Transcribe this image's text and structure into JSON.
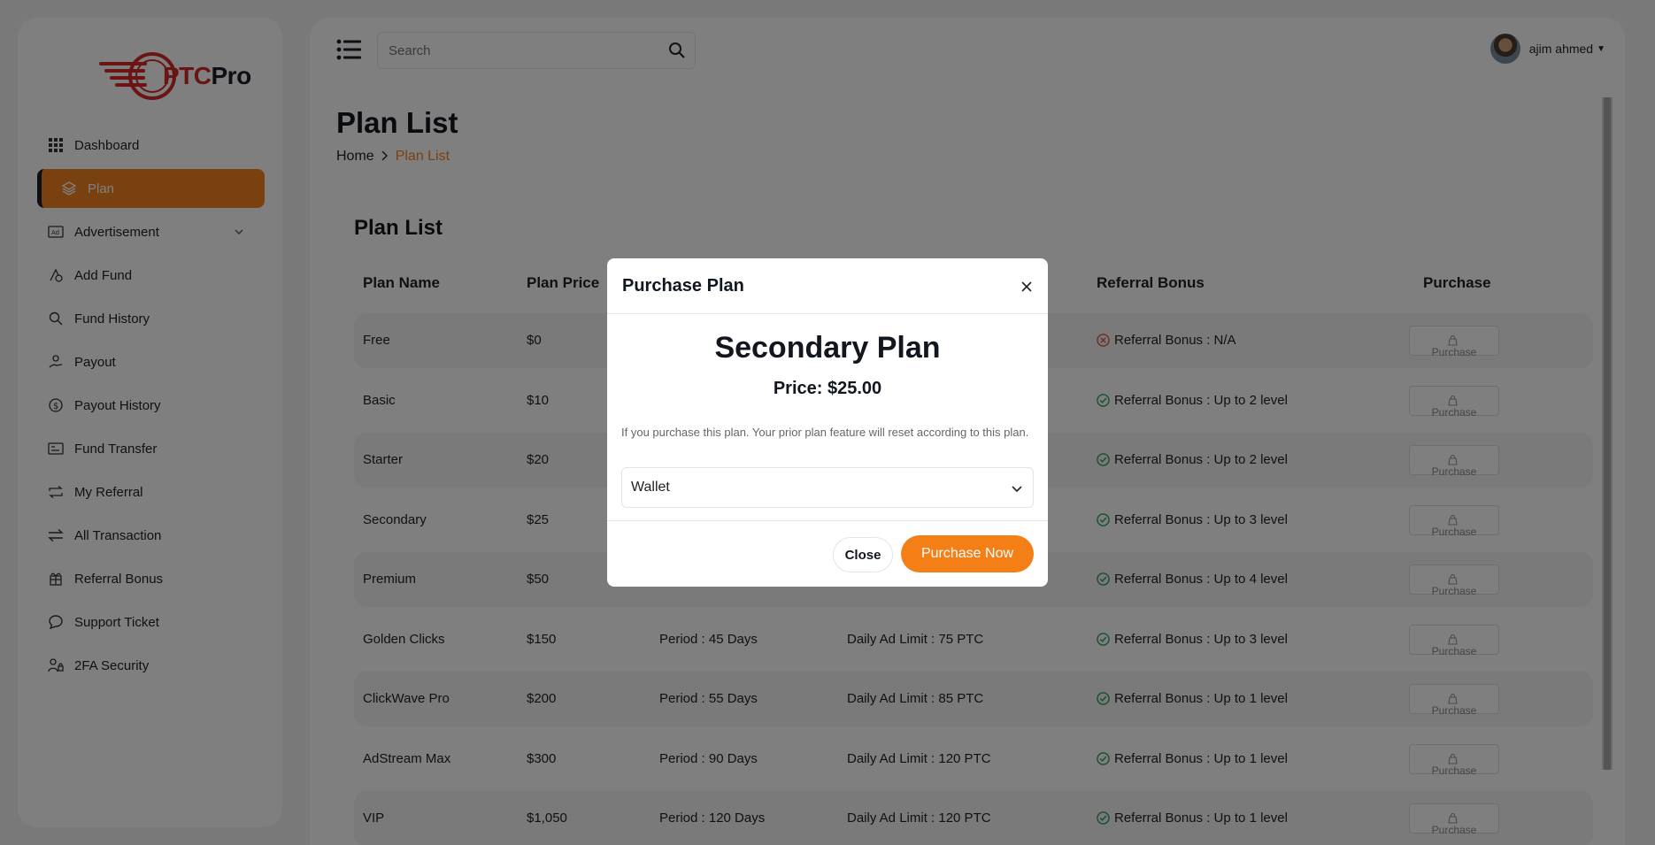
{
  "brand": {
    "logo_ptc": "PTC",
    "logo_pro": "Pro"
  },
  "sidebar": {
    "items": [
      {
        "label": "Dashboard",
        "icon": "grid-icon"
      },
      {
        "label": "Plan",
        "icon": "layers-icon",
        "active": true
      },
      {
        "label": "Advertisement",
        "icon": "ad-icon",
        "has_submenu": true
      },
      {
        "label": "Add Fund",
        "icon": "fund-icon"
      },
      {
        "label": "Fund History",
        "icon": "search-dollar-icon"
      },
      {
        "label": "Payout",
        "icon": "payout-icon"
      },
      {
        "label": "Payout History",
        "icon": "dollar-circle-icon"
      },
      {
        "label": "Fund Transfer",
        "icon": "card-icon"
      },
      {
        "label": "My Referral",
        "icon": "repeat-icon"
      },
      {
        "label": "All Transaction",
        "icon": "transfer-icon"
      },
      {
        "label": "Referral Bonus",
        "icon": "gift-icon"
      },
      {
        "label": "Support Ticket",
        "icon": "chat-icon"
      },
      {
        "label": "2FA Security",
        "icon": "user-lock-icon"
      }
    ]
  },
  "topbar": {
    "search_placeholder": "Search",
    "user_name": "ajim ahmed"
  },
  "page": {
    "title": "Plan List",
    "breadcrumb_home": "Home",
    "breadcrumb_current": "Plan List"
  },
  "table": {
    "title": "Plan List",
    "headers": {
      "name": "Plan Name",
      "price": "Plan Price",
      "referral": "Referral Bonus",
      "purchase": "Purchase"
    },
    "purchase_label": "Purchase",
    "rows": [
      {
        "name": "Free",
        "price": "$0",
        "period": "",
        "limit": "",
        "referral": "Referral Bonus : N/A",
        "ref_ok": false
      },
      {
        "name": "Basic",
        "price": "$10",
        "period": "",
        "limit": "",
        "referral": "Referral Bonus : Up to 2 level",
        "ref_ok": true
      },
      {
        "name": "Starter",
        "price": "$20",
        "period": "",
        "limit": "",
        "referral": "Referral Bonus : Up to 2 level",
        "ref_ok": true
      },
      {
        "name": "Secondary",
        "price": "$25",
        "period": "",
        "limit": "",
        "referral": "Referral Bonus : Up to 3 level",
        "ref_ok": true
      },
      {
        "name": "Premium",
        "price": "$50",
        "period": "",
        "limit": "",
        "referral": "Referral Bonus : Up to 4 level",
        "ref_ok": true
      },
      {
        "name": "Golden Clicks",
        "price": "$150",
        "period": "Period : 45 Days",
        "limit": "Daily Ad Limit : 75 PTC",
        "referral": "Referral Bonus : Up to 3 level",
        "ref_ok": true
      },
      {
        "name": "ClickWave Pro",
        "price": "$200",
        "period": "Period : 55 Days",
        "limit": "Daily Ad Limit : 85 PTC",
        "referral": "Referral Bonus : Up to 1 level",
        "ref_ok": true
      },
      {
        "name": "AdStream Max",
        "price": "$300",
        "period": "Period : 90 Days",
        "limit": "Daily Ad Limit : 120 PTC",
        "referral": "Referral Bonus : Up to 1 level",
        "ref_ok": true
      },
      {
        "name": "VIP",
        "price": "$1,050",
        "period": "Period : 120 Days",
        "limit": "Daily Ad Limit : 120 PTC",
        "referral": "Referral Bonus : Up to 1 level",
        "ref_ok": true
      }
    ]
  },
  "modal": {
    "title": "Purchase Plan",
    "plan_name": "Secondary Plan",
    "price": "Price: $25.00",
    "note": "If you purchase this plan. Your prior plan feature will reset according to this plan.",
    "payment_method": "Wallet",
    "close_label": "Close",
    "purchase_label": "Purchase Now"
  },
  "colors": {
    "accent": "#f58220",
    "ok": "#2e9e5b",
    "error": "#e05252"
  }
}
